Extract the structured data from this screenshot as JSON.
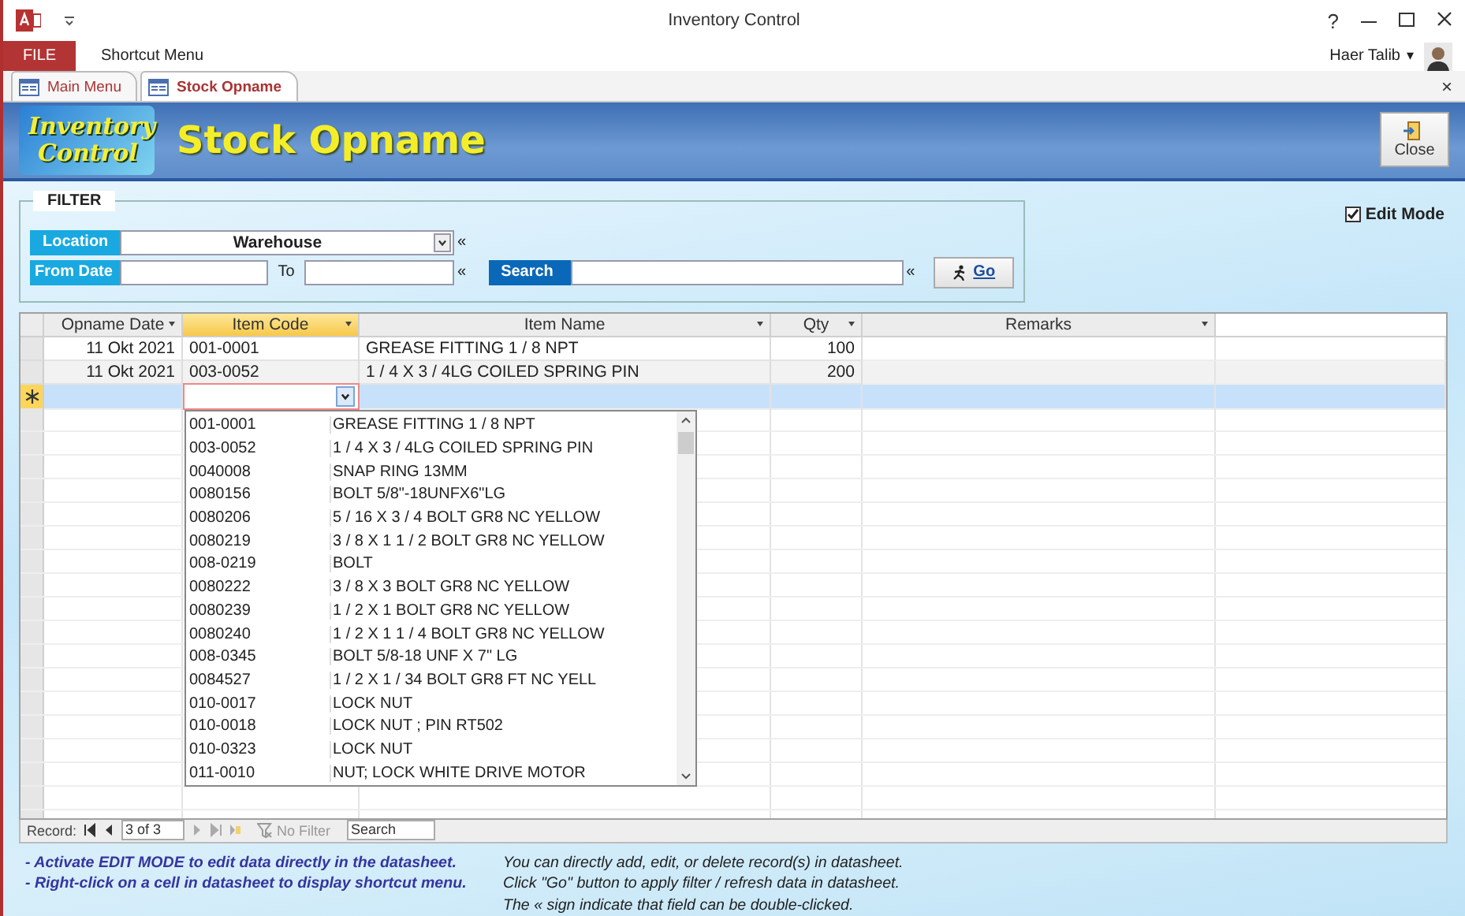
{
  "window": {
    "title": "Inventory Control",
    "help": "?"
  },
  "ribbon": {
    "file_tab": "FILE",
    "menu": "Shortcut Menu",
    "user": "Haer Talib",
    "user_caret": "▾",
    "close_tab": "×"
  },
  "doc_tabs": [
    {
      "label": "Main Menu",
      "selected": false
    },
    {
      "label": "Stock Opname",
      "selected": true
    }
  ],
  "header": {
    "logo_lines": [
      "Inventory",
      "Control"
    ],
    "title": "Stock Opname",
    "close_button": "Close"
  },
  "filter": {
    "title": "FILTER",
    "location_label": "Location",
    "location_value": "Warehouse",
    "from_date_label": "From Date",
    "to_label": "To",
    "search_label": "Search",
    "marker": "«",
    "go_button": "Go"
  },
  "edit_mode": {
    "label": "Edit Mode",
    "checked": true
  },
  "datasheet": {
    "columns": [
      {
        "label": "Opname Date",
        "selected": false
      },
      {
        "label": "Item Code",
        "selected": true
      },
      {
        "label": "Item Name",
        "selected": false
      },
      {
        "label": "Qty",
        "selected": false
      },
      {
        "label": "Remarks",
        "selected": false
      }
    ],
    "rows": [
      {
        "cells": [
          "11 Okt 2021",
          "001-0001",
          "GREASE FITTING 1 / 8 NPT",
          "100",
          ""
        ]
      },
      {
        "cells": [
          "11 Okt 2021",
          "003-0052",
          "1 / 4 X 3 / 4LG COILED SPRING PIN",
          "200",
          ""
        ]
      }
    ],
    "new_row_selected": true
  },
  "dropdown": [
    {
      "code": "001-0001",
      "name": "GREASE FITTING 1 / 8 NPT"
    },
    {
      "code": "003-0052",
      "name": "1 / 4 X 3 / 4LG COILED SPRING PIN"
    },
    {
      "code": "0040008",
      "name": "SNAP RING 13MM"
    },
    {
      "code": "0080156",
      "name": "BOLT 5/8\"-18UNFX6\"LG"
    },
    {
      "code": "0080206",
      "name": "5 / 16 X 3 / 4 BOLT GR8 NC YELLOW"
    },
    {
      "code": "0080219",
      "name": "3 / 8 X 1 1 / 2 BOLT GR8 NC YELLOW"
    },
    {
      "code": "008-0219",
      "name": "BOLT"
    },
    {
      "code": "0080222",
      "name": "3 / 8 X 3 BOLT GR8 NC YELLOW"
    },
    {
      "code": "0080239",
      "name": "1 / 2 X 1 BOLT GR8 NC YELLOW"
    },
    {
      "code": "0080240",
      "name": "1 / 2 X 1 1 / 4 BOLT GR8 NC YELLOW"
    },
    {
      "code": "008-0345",
      "name": "BOLT 5/8-18 UNF X 7\" LG"
    },
    {
      "code": "0084527",
      "name": "1 / 2 X 1 / 34 BOLT GR8 FT NC YELL"
    },
    {
      "code": "010-0017",
      "name": "LOCK NUT"
    },
    {
      "code": "010-0018",
      "name": "LOCK NUT ; PIN RT502"
    },
    {
      "code": "010-0323",
      "name": "LOCK NUT"
    },
    {
      "code": "011-0010",
      "name": "NUT; LOCK WHITE DRIVE MOTOR"
    }
  ],
  "record_nav": {
    "label": "Record:",
    "position": "3 of 3",
    "filter": "No Filter",
    "search": "Search"
  },
  "notes_left": [
    "- Activate EDIT MODE to edit data directly in the datasheet.",
    "- Right-click on a cell in datasheet to display shortcut menu."
  ],
  "notes_right": [
    "You can directly add, edit, or delete record(s) in datasheet.",
    "Click \"Go\" button to apply filter / refresh data in datasheet.",
    "The « sign indicate that field can be double-clicked."
  ]
}
